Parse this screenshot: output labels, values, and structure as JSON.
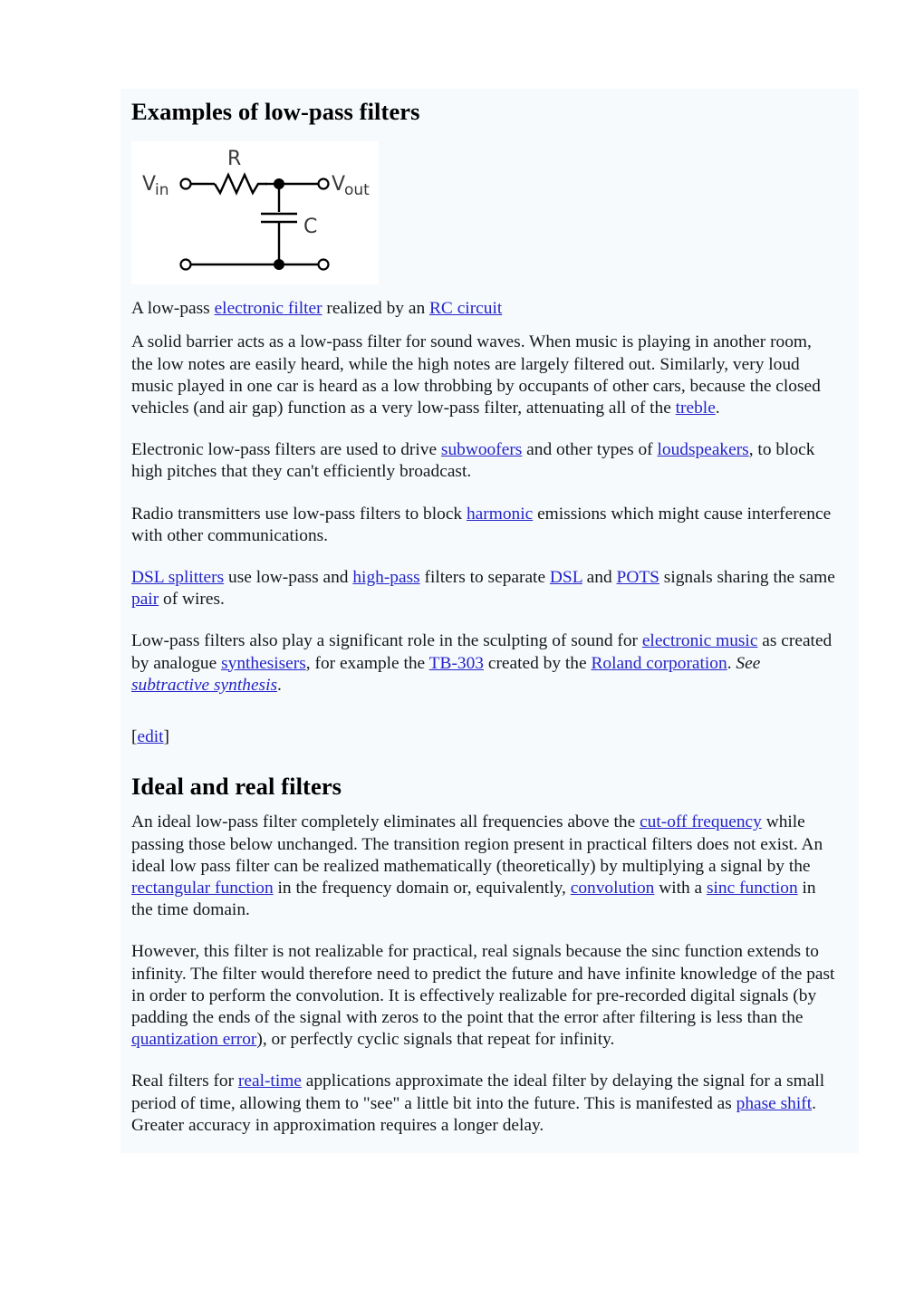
{
  "page": {
    "background_color": "#ffffff",
    "content_background_color": "#f6fafd",
    "link_color": "#2424c8",
    "text_color": "#171717"
  },
  "headings": {
    "examples": "Examples of low-pass filters",
    "ideal_real": "Ideal and real filters"
  },
  "figure": {
    "alt": "rc-low-pass-circuit-diagram",
    "labels": {
      "vin_main": "V",
      "vin_sub": "in",
      "vout_main": "V",
      "vout_sub": "out",
      "resistor": "R",
      "capacitor": "C"
    }
  },
  "caption": {
    "t1": "A low-pass ",
    "l1": "electronic filter",
    "t2": " realized by an ",
    "l2": "RC circuit"
  },
  "paragraphs": {
    "barrier": {
      "t1": "A solid barrier acts as a low-pass filter for sound waves. When music is playing in another room, the low notes are easily heard, while the high notes are largely filtered out. Similarly, very loud music played in one car is heard as a low throbbing by occupants of other cars, because the closed vehicles (and air gap) function as a very low-pass filter, attenuating all of the ",
      "l1": "treble",
      "t2": "."
    },
    "subwoofers": {
      "t1": "Electronic low-pass filters are used to drive ",
      "l1": "subwoofers",
      "t2": " and other types of ",
      "l2": "loudspeakers",
      "t3": ", to block high pitches that they can't efficiently broadcast."
    },
    "radio": {
      "t1": "Radio transmitters use low-pass filters to block ",
      "l1": "harmonic",
      "t2": " emissions which might cause interference with other communications."
    },
    "dsl": {
      "l1": "DSL splitters",
      "t1": " use low-pass and ",
      "l2": "high-pass",
      "t2": " filters to separate ",
      "l3": "DSL",
      "t3": " and ",
      "l4": "POTS",
      "t4": " signals sharing the same ",
      "l5": "pair",
      "t5": " of wires."
    },
    "music": {
      "t1": "Low-pass filters also play a significant role in the sculpting of sound for ",
      "l1": "electronic music",
      "t2": " as created by analogue ",
      "l2": "synthesisers",
      "t3": ", for example the ",
      "l3": "TB-303",
      "t4": " created by the ",
      "l4": "Roland corporation",
      "t5": ". ",
      "italic_see": "See ",
      "l5": "subtractive synthesis",
      "t6": "."
    },
    "edit": {
      "open": "[",
      "link": "edit",
      "close": "]"
    },
    "ideal": {
      "t1": "An ideal low-pass filter completely eliminates all frequencies above the ",
      "l1": "cut-off frequency",
      "t2": " while passing those below unchanged. The transition region present in practical filters does not exist. An ideal low pass filter can be realized mathematically (theoretically) by multiplying a signal by the ",
      "l2": "rectangular function",
      "t3": " in the frequency domain or, equivalently, ",
      "l3": "convolution",
      "t4": " with a ",
      "l4": "sinc function",
      "t5": " in the time domain."
    },
    "however": {
      "t1": "However, this filter is not realizable for practical, real signals because the sinc function extends to infinity. The filter would therefore need to predict the future and have infinite knowledge of the past in order to perform the convolution. It is effectively realizable for pre-recorded digital signals (by padding the ends of the signal with zeros to the point that the error after filtering is less than the ",
      "l1": "quantization error",
      "t2": "), or perfectly cyclic signals that repeat for infinity."
    },
    "realfilters": {
      "t1": "Real filters for ",
      "l1": "real-time",
      "t2": " applications approximate the ideal filter by delaying the signal for a small period of time, allowing them to \"see\" a little bit into the future. This is manifested as ",
      "l2": "phase shift",
      "t3": ". Greater accuracy in approximation requires a longer delay."
    }
  }
}
